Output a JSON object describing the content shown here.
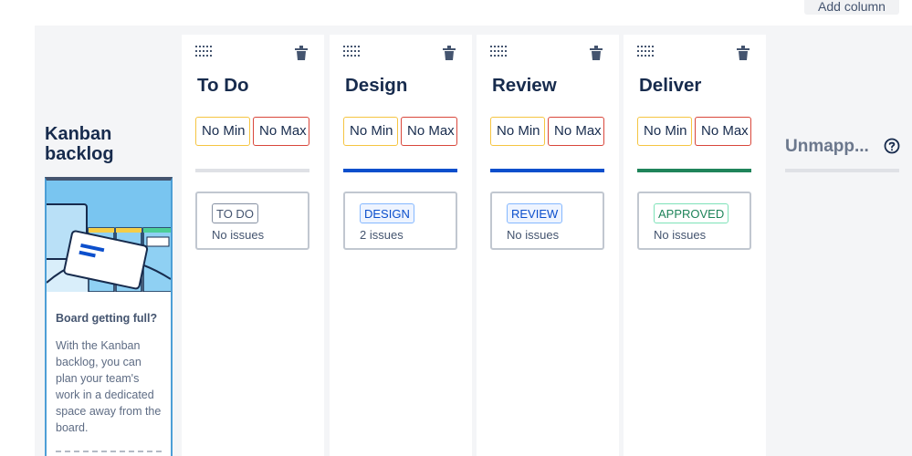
{
  "header": {
    "add_column_label": "Add column"
  },
  "backlog": {
    "title_line1": "Kanban",
    "title_line2": "backlog",
    "card_heading": "Board getting full?",
    "card_text": "With the Kanban backlog, you can plan your team's work in a dedicated space away from the board."
  },
  "columns": [
    {
      "name": "To Do",
      "min": "No Min",
      "max": "No Max",
      "bar_color": "#dfe1e6",
      "status": "TO DO",
      "status_color": "#44546f",
      "status_bg": "#ffffff",
      "status_border": "#8590a2",
      "issues": "No issues"
    },
    {
      "name": "Design",
      "min": "No Min",
      "max": "No Max",
      "bar_color": "#0c4fcc",
      "status": "DESIGN",
      "status_color": "#0c4fcc",
      "status_bg": "#eef4ff",
      "status_border": "#85b8ff",
      "issues": "2 issues"
    },
    {
      "name": "Review",
      "min": "No Min",
      "max": "No Max",
      "bar_color": "#0c4fcc",
      "status": "REVIEW",
      "status_color": "#0c4fcc",
      "status_bg": "#eef4ff",
      "status_border": "#85b8ff",
      "issues": "No issues"
    },
    {
      "name": "Deliver",
      "min": "No Min",
      "max": "No Max",
      "bar_color": "#1f845a",
      "status": "APPROVED",
      "status_color": "#1f845a",
      "status_bg": "#ffffff",
      "status_border": "#7ee2b8",
      "issues": "No issues"
    }
  ],
  "unmapped": {
    "title": "Unmapp..."
  },
  "icons": {
    "drag": "drag-handle-icon",
    "trash": "trash-icon",
    "help": "help-circle-icon"
  }
}
